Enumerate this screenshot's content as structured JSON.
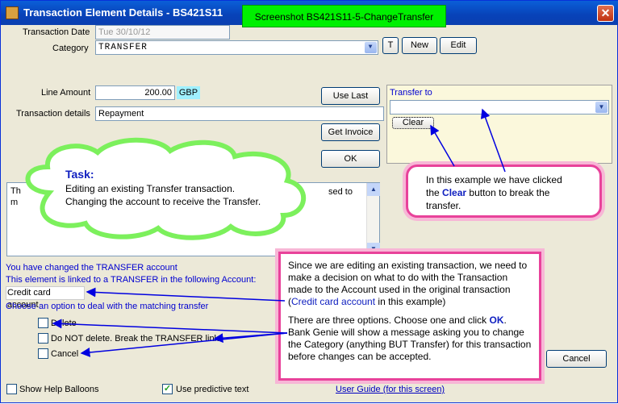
{
  "window": {
    "title": "Transaction Element Details - BS421S11",
    "close_label": "✕",
    "banner": "Screenshot BS421S11-5-ChangeTransfer"
  },
  "form": {
    "date_label": "Transaction Date",
    "date_value": "Tue 30/10/12",
    "category_label": "Category",
    "category_value": "TRANSFER",
    "t_button": "T",
    "new_button": "New",
    "edit_button": "Edit",
    "amount_label": "Line Amount",
    "amount_value": "200.00",
    "currency": "GBP",
    "details_label": "Transaction details",
    "details_value": "Repayment",
    "use_last_button": "Use Last",
    "get_invoice_button": "Get Invoice",
    "ok_button": "OK",
    "memo_fragment_1": "Th",
    "memo_fragment_2": "m",
    "memo_fragment_3": "sed to"
  },
  "transfer": {
    "label": "Transfer to",
    "value": "",
    "clear_button": "Clear"
  },
  "notice": {
    "line1": "You have changed the TRANSFER account",
    "line2": "This element is linked to  a TRANSFER in the following Account:",
    "account": "Credit card account",
    "line3": "Choose an option to deal with the matching transfer",
    "options": [
      "Delete",
      "Do NOT delete. Break the TRANSFER link",
      "Cancel"
    ]
  },
  "footer": {
    "help_balloons": "Show Help Balloons",
    "predictive": "Use predictive text",
    "user_guide": "User Guide (for this screen)",
    "cancel_button": "Cancel"
  },
  "annotations": {
    "task_title": "Task:",
    "task_line1": "Editing an existing Transfer transaction.",
    "task_line2": "Changing the account to receive the Transfer.",
    "clear_note_1": "In this example we have clicked",
    "clear_note_2": "the",
    "clear_note_clear": "Clear",
    "clear_note_3": "button to break the",
    "clear_note_4": "transfer.",
    "options_p1": "Since we are editing an existing transaction, we need to make a decision on what to do with the Transaction made to the Account used in the original transaction (",
    "options_p1_link": "Credit card account",
    "options_p1_end": " in this example)",
    "options_p2a": "There are three options. Choose one and click ",
    "options_p2_ok": "OK",
    "options_p2b": ".",
    "options_p3": "Bank Genie will show a message asking you to change the Category (anything BUT Transfer) for this transaction before changes can be accepted."
  },
  "colors": {
    "banner": "#00f000",
    "callout_border": "#e8429a",
    "arrow": "#0000e0",
    "cloud": "#7cf05c"
  }
}
